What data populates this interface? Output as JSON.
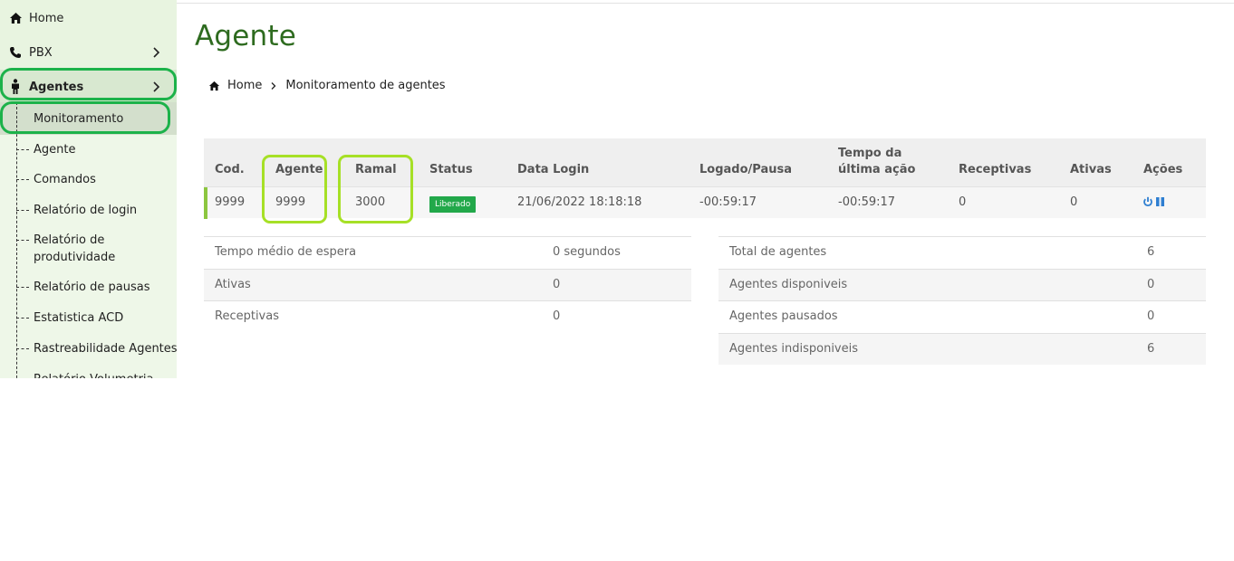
{
  "sidebar": {
    "items": [
      {
        "label": "Home",
        "icon": "home-icon"
      },
      {
        "label": "PBX",
        "icon": "phone-icon"
      },
      {
        "label": "Agentes",
        "icon": "person-icon"
      }
    ],
    "submenu": [
      "Monitoramento",
      "Agente",
      "Comandos",
      "Relatório de login",
      "Relatório de produtividade",
      "Relatório de pausas",
      "Estatistica ACD",
      "Rastreabilidade Agentes",
      "Relatório Volumetria"
    ]
  },
  "page": {
    "title": "Agente",
    "breadcrumb": {
      "home": "Home",
      "current": "Monitoramento de agentes"
    }
  },
  "agents_table": {
    "headers": {
      "cod": "Cod.",
      "agente": "Agente",
      "ramal": "Ramal",
      "status": "Status",
      "data_login": "Data Login",
      "logado_pausa": "Logado/Pausa",
      "tempo_ultima_acao_1": "Tempo da",
      "tempo_ultima_acao_2": "última ação",
      "receptivas": "Receptivas",
      "ativas": "Ativas",
      "acoes": "Ações"
    },
    "rows": [
      {
        "cod": "9999",
        "agente": "9999",
        "ramal": "3000",
        "status": "Liberado",
        "data_login": "21/06/2022 18:18:18",
        "logado_pausa": "-00:59:17",
        "tempo_ultima_acao": "-00:59:17",
        "receptivas": "0",
        "ativas": "0"
      }
    ]
  },
  "stats_left": [
    {
      "label": "Tempo médio de espera",
      "value": "0 segundos"
    },
    {
      "label": "Ativas",
      "value": "0"
    },
    {
      "label": "Receptivas",
      "value": "0"
    }
  ],
  "stats_right": [
    {
      "label": "Total de agentes",
      "value": "6"
    },
    {
      "label": "Agentes disponiveis",
      "value": "0"
    },
    {
      "label": "Agentes pausados",
      "value": "0"
    },
    {
      "label": "Agentes indisponiveis",
      "value": "6"
    }
  ],
  "colors": {
    "title_green": "#2e6b1f",
    "status_badge": "#22a84a",
    "annotation_green": "#1cb24a",
    "annotation_lime": "#a6e026",
    "action_blue": "#2f7fd1"
  }
}
